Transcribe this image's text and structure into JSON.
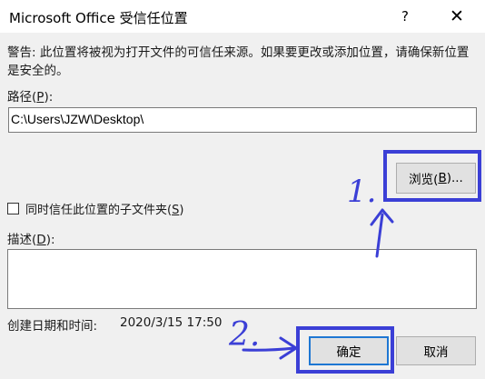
{
  "window": {
    "title": "Microsoft Office 受信任位置",
    "help_label": "?",
    "close_label": "✕"
  },
  "warning_text": "警告: 此位置将被视为打开文件的可信任来源。如果要更改或添加位置，请确保新位置是安全的。",
  "path": {
    "label_prefix": "路径(",
    "label_key": "P",
    "label_suffix": "):",
    "value": "C:\\Users\\JZW\\Desktop\\"
  },
  "browse_button": {
    "prefix": "浏览(",
    "key": "B",
    "suffix": ")..."
  },
  "subfolders_checkbox": {
    "checked": false,
    "label_prefix": "同时信任此位置的子文件夹(",
    "label_key": "S",
    "label_suffix": ")"
  },
  "description": {
    "label_prefix": "描述(",
    "label_key": "D",
    "label_suffix": "):",
    "value": ""
  },
  "created": {
    "label": "创建日期和时间:",
    "value": "2020/3/15 17:50"
  },
  "ok_button": {
    "label": "确定"
  },
  "cancel_button": {
    "label": "取消"
  },
  "annotations": {
    "step1": "1.",
    "step2": "2.",
    "highlight_color": "#3b3fd6"
  }
}
